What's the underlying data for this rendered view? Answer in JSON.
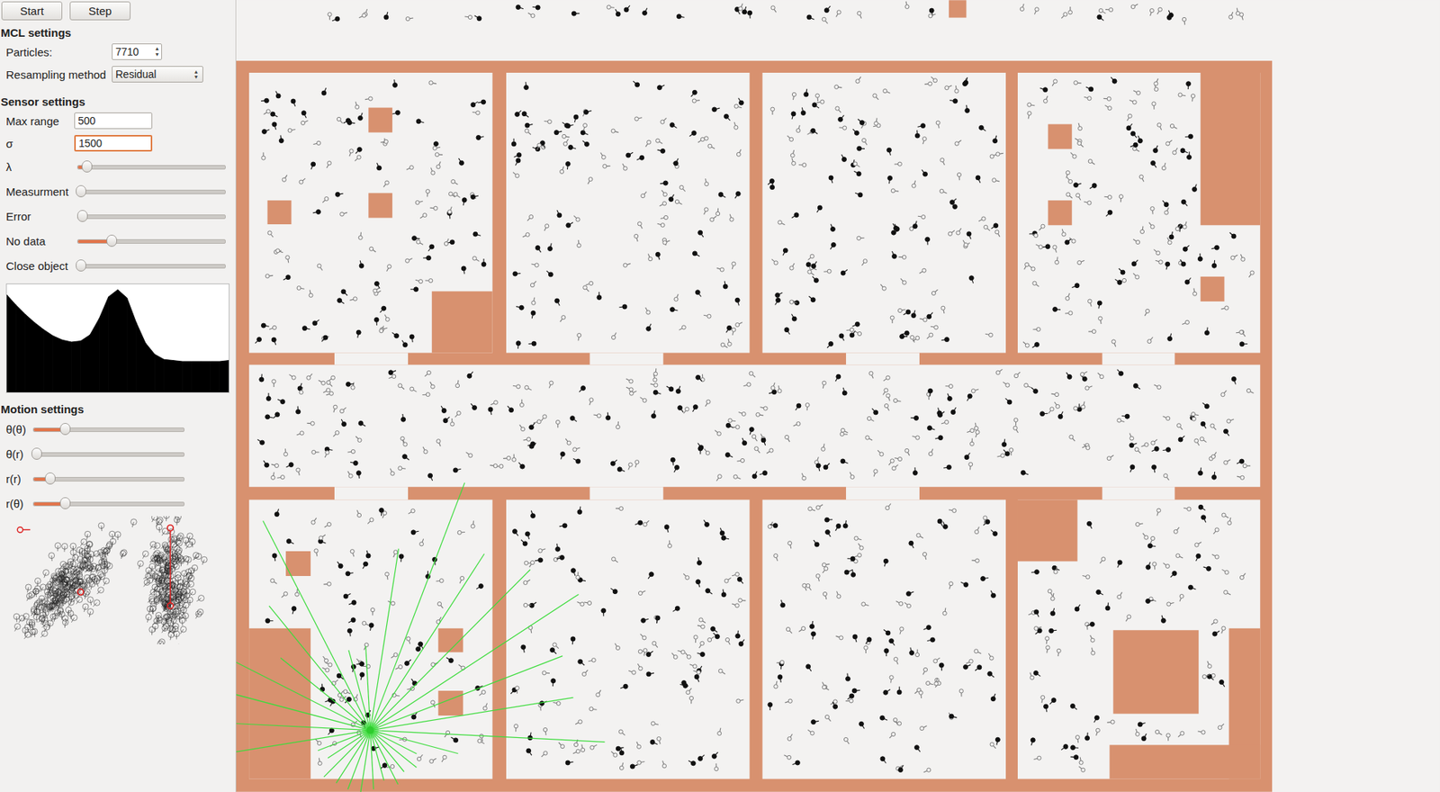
{
  "toolbar": {
    "buttons": [
      {
        "label": "Start"
      },
      {
        "label": "Step"
      }
    ]
  },
  "mcl_settings": {
    "title": "MCL settings",
    "particles": {
      "label": "Particles:",
      "value": "7710"
    },
    "resampling": {
      "label": "Resampling method",
      "value": "Residual"
    }
  },
  "sensor_settings": {
    "title": "Sensor settings",
    "max_range": {
      "label": "Max range",
      "value": "500",
      "focused": false
    },
    "sigma": {
      "label": "σ",
      "value": "1500",
      "focused": true
    },
    "sliders": [
      {
        "label": "λ",
        "level": 0.06
      },
      {
        "label": "Measurment",
        "level": 0.02
      },
      {
        "label": "Error",
        "level": 0.03
      },
      {
        "label": "No data",
        "level": 0.23
      },
      {
        "label": "Close object",
        "level": 0.02
      }
    ]
  },
  "sensor_chart": {
    "values": [
      0.95,
      0.85,
      0.76,
      0.68,
      0.61,
      0.55,
      0.51,
      0.49,
      0.5,
      0.56,
      0.72,
      0.93,
      1.0,
      0.92,
      0.68,
      0.48,
      0.37,
      0.32,
      0.31,
      0.3,
      0.3,
      0.3,
      0.3,
      0.3,
      0.31
    ]
  },
  "motion_settings": {
    "title": "Motion settings",
    "sliders": [
      {
        "label": "θ(θ)",
        "level": 0.21
      },
      {
        "label": "θ(r)",
        "level": 0.02
      },
      {
        "label": "r(r)",
        "level": 0.11
      },
      {
        "label": "r(θ)",
        "level": 0.21
      }
    ]
  }
}
